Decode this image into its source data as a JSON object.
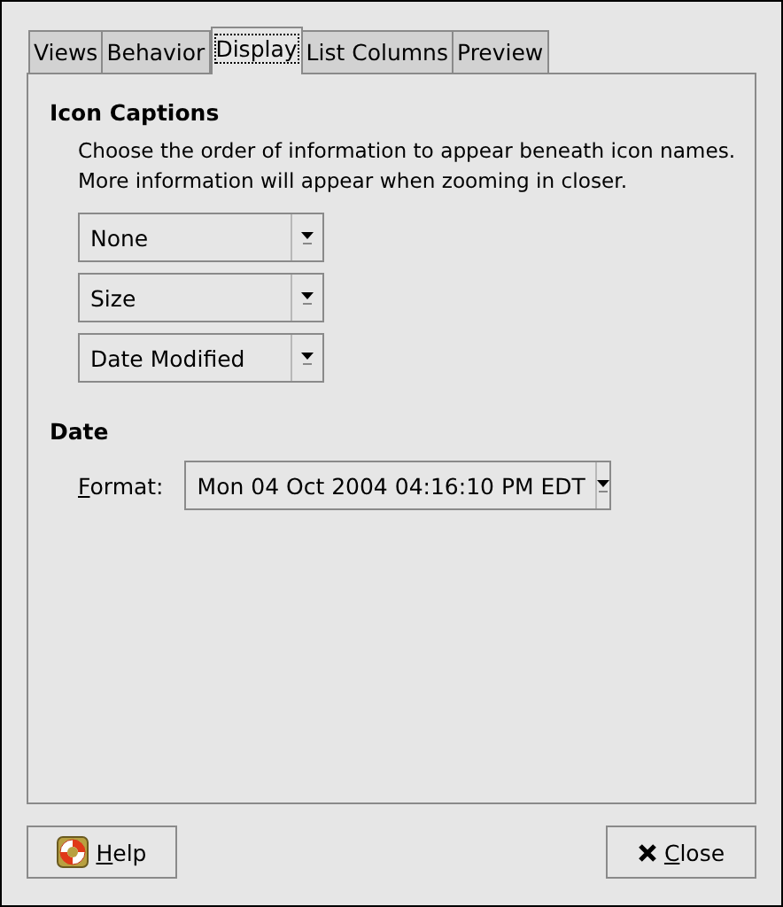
{
  "tabs": [
    {
      "label": "Views",
      "selected": false
    },
    {
      "label": "Behavior",
      "selected": false
    },
    {
      "label": "Display",
      "selected": true
    },
    {
      "label": "List Columns",
      "selected": false
    },
    {
      "label": "Preview",
      "selected": false
    }
  ],
  "icon_captions": {
    "heading": "Icon Captions",
    "description": "Choose the order of information to appear beneath icon names.\nMore information will appear when zooming in closer.",
    "dropdowns": [
      {
        "value": "None"
      },
      {
        "value": "Size"
      },
      {
        "value": "Date Modified"
      }
    ]
  },
  "date": {
    "heading": "Date",
    "format_label": "Format:",
    "format_mnemonic": true,
    "format_value": "Mon 04 Oct 2004 04:16:10 PM EDT"
  },
  "buttons": [
    {
      "kind": "help",
      "label": "Help",
      "mnemonic": true
    },
    {
      "kind": "close",
      "label": "Close",
      "mnemonic": true
    }
  ]
}
